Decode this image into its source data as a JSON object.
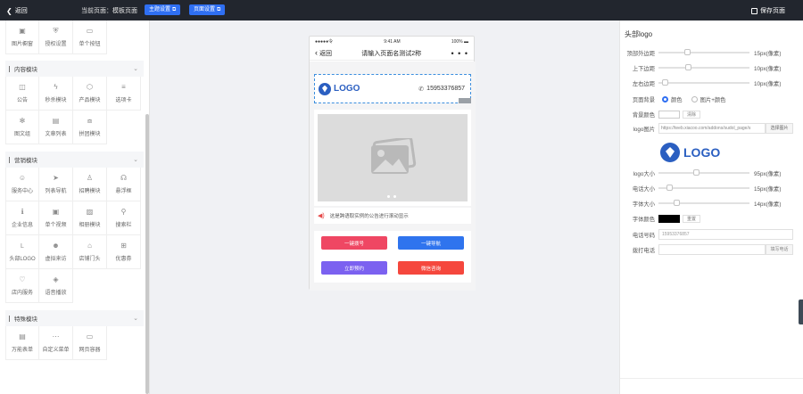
{
  "topbar": {
    "back_label": "返回",
    "current_page": "当前页面：模板页面",
    "theme_settings": "主题设置",
    "page_settings": "页面设置",
    "save_label": "保存页面"
  },
  "left_panel": {
    "top_items": [
      {
        "label": "图片橱窗",
        "icon": "image-icon"
      },
      {
        "label": "授权设置",
        "icon": "shield-icon"
      },
      {
        "label": "单个按钮",
        "icon": "button-icon"
      }
    ],
    "sections": [
      {
        "title": "内容模块",
        "items": [
          {
            "label": "公告",
            "icon": "notice-icon"
          },
          {
            "label": "秒杀模块",
            "icon": "flash-icon"
          },
          {
            "label": "产品模块",
            "icon": "box-icon"
          },
          {
            "label": "选项卡",
            "icon": "tabs-icon"
          },
          {
            "label": "图文组",
            "icon": "image-text-icon"
          },
          {
            "label": "文章列表",
            "icon": "article-icon"
          },
          {
            "label": "拼团模块",
            "icon": "group-icon"
          }
        ]
      },
      {
        "title": "营销模块",
        "items": [
          {
            "label": "服务中心",
            "icon": "service-icon"
          },
          {
            "label": "列表导航",
            "icon": "navigation-icon"
          },
          {
            "label": "招聘模块",
            "icon": "recruit-icon"
          },
          {
            "label": "悬浮框",
            "icon": "headset-icon"
          },
          {
            "label": "企业信息",
            "icon": "info-icon"
          },
          {
            "label": "单个视频",
            "icon": "video-icon"
          },
          {
            "label": "相册模块",
            "icon": "album-icon"
          },
          {
            "label": "搜索栏",
            "icon": "search-icon"
          },
          {
            "label": "头部LOGO",
            "icon": "logo-icon"
          },
          {
            "label": "虚拟来访",
            "icon": "visitor-icon"
          },
          {
            "label": "店铺门头",
            "icon": "shop-icon"
          },
          {
            "label": "优惠券",
            "icon": "coupon-icon"
          },
          {
            "label": "店内服务",
            "icon": "store-service-icon"
          },
          {
            "label": "语音播放",
            "icon": "audio-icon"
          }
        ]
      },
      {
        "title": "特殊模块",
        "items": [
          {
            "label": "万能表单",
            "icon": "form-icon"
          },
          {
            "label": "自定义菜单",
            "icon": "menu-icon"
          },
          {
            "label": "网页容器",
            "icon": "webpage-icon"
          }
        ]
      }
    ]
  },
  "phone": {
    "status_carrier": "●●●●●令",
    "status_time": "9:41 AM",
    "status_battery": "100%",
    "nav_back": "返回",
    "nav_title": "请输入页面名测试2称",
    "nav_more": "• • •",
    "logo_text": "LOGO",
    "phone_number": "15953376857",
    "notice_text": "这是跨语取实例的公告进行滚动显示",
    "buttons": [
      {
        "label": "一键拨号",
        "color": "#ef4763"
      },
      {
        "label": "一键导航",
        "color": "#2f74ee"
      },
      {
        "label": "立即预约",
        "color": "#7b61f0"
      },
      {
        "label": "微信咨询",
        "color": "#f5473d"
      }
    ]
  },
  "settings": {
    "title": "头部logo",
    "top_margin": {
      "label": "顶部外边距",
      "value": "15px(像素)"
    },
    "vertical_margin": {
      "label": "上下边距",
      "value": "10px(像素)"
    },
    "horizontal_margin": {
      "label": "左右边距",
      "value": "10px(像素)"
    },
    "page_bg": {
      "label": "页面背景",
      "option_color": "颜色",
      "option_image": "图片+颜色"
    },
    "bg_color": {
      "label": "背景颜色",
      "clear": "清除"
    },
    "logo_image": {
      "label": "logo图片",
      "url": "https://teeb.xiacoo.com/addons/sudol_page/s",
      "pick": "选择图片"
    },
    "logo_size": {
      "label": "logo大小",
      "value": "95px(像素)"
    },
    "phone_size": {
      "label": "电话大小",
      "value": "15px(像素)"
    },
    "font_size": {
      "label": "字体大小",
      "value": "14px(像素)"
    },
    "font_color": {
      "label": "字体颜色",
      "reset": "重置",
      "color": "#000000"
    },
    "phone_number": {
      "label": "电话号码",
      "value": "15953376857"
    },
    "call": {
      "label": "拨打电话",
      "button": "填写电话"
    }
  },
  "colors": {
    "accent": "#2f6ff2",
    "topbar_bg": "#22262e",
    "logo_blue": "#2b5fc1"
  }
}
